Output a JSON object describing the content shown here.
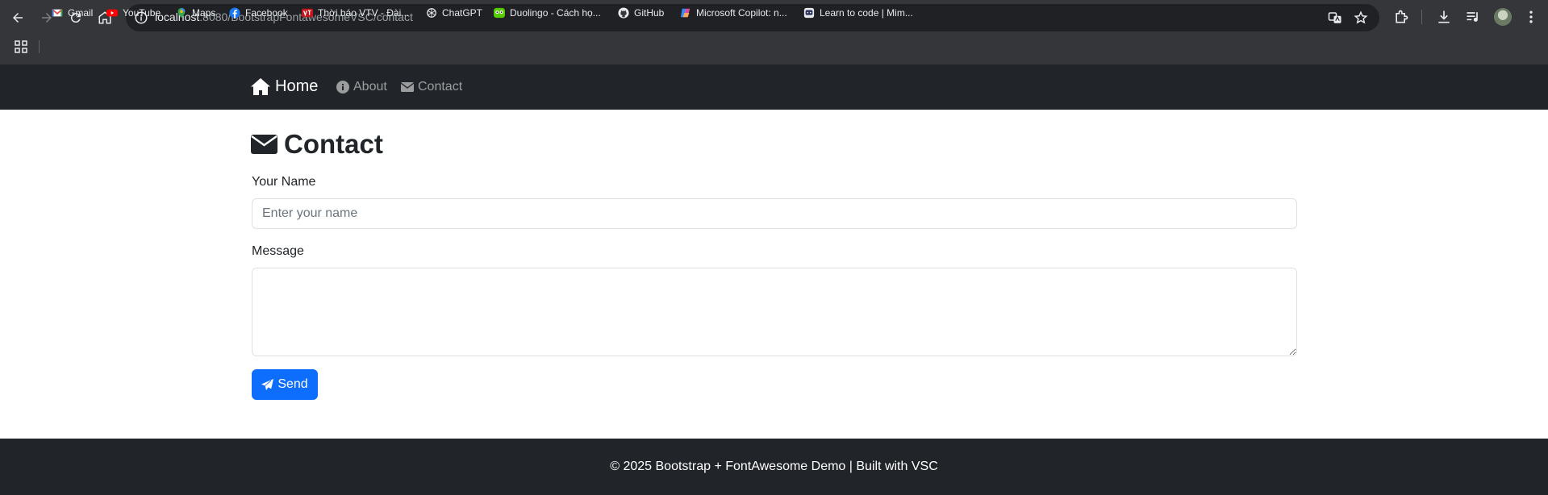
{
  "browser": {
    "url_host": "localhost",
    "url_rest": ":8080/BootstrapFontawesomeVSC/contact",
    "bookmarks": [
      {
        "label": "Gmail",
        "icon": "gmail-icon"
      },
      {
        "label": "YouTube",
        "icon": "youtube-icon"
      },
      {
        "label": "Maps",
        "icon": "maps-icon"
      },
      {
        "label": "Facebook",
        "icon": "facebook-icon"
      },
      {
        "label": "Thời báo VTV - Đài...",
        "icon": "vtv-icon"
      },
      {
        "label": "ChatGPT",
        "icon": "chatgpt-icon"
      },
      {
        "label": "Duolingo - Cách họ...",
        "icon": "duolingo-icon"
      },
      {
        "label": "GitHub",
        "icon": "github-icon"
      },
      {
        "label": "Microsoft Copilot: n...",
        "icon": "copilot-icon"
      },
      {
        "label": "Learn to code | Mim...",
        "icon": "mimo-icon"
      }
    ]
  },
  "navbar": {
    "brand": "Home",
    "links": [
      {
        "label": "About",
        "icon": "info-circle-icon"
      },
      {
        "label": "Contact",
        "icon": "envelope-icon"
      }
    ]
  },
  "page": {
    "title": "Contact",
    "name_label": "Your Name",
    "name_placeholder": "Enter your name",
    "name_value": "",
    "message_label": "Message",
    "message_value": "",
    "send_label": "Send"
  },
  "footer": {
    "text": "© 2025 Bootstrap + FontAwesome Demo | Built with VSC"
  },
  "colors": {
    "chrome_bg": "#35363a",
    "omnibox_bg": "#202124",
    "navbar_bg": "#212529",
    "primary": "#0d6efd"
  }
}
